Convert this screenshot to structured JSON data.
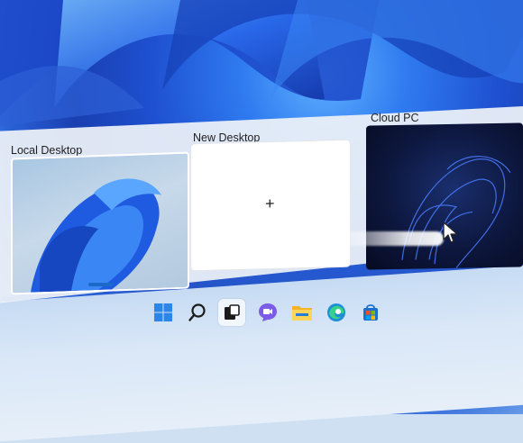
{
  "desktops": [
    {
      "label": "Local Desktop",
      "active": true
    },
    {
      "label": "New Desktop",
      "content": "+"
    },
    {
      "label": "Cloud PC"
    }
  ],
  "taskbar": {
    "icons": [
      "windows-start-icon",
      "search-icon",
      "task-view-icon",
      "chat-icon",
      "file-explorer-icon",
      "edge-icon",
      "store-icon"
    ]
  },
  "colors": {
    "accent": "#1b6ac9",
    "wallpaper_blue": "#1e50d0",
    "panel": "#eef2f8"
  }
}
